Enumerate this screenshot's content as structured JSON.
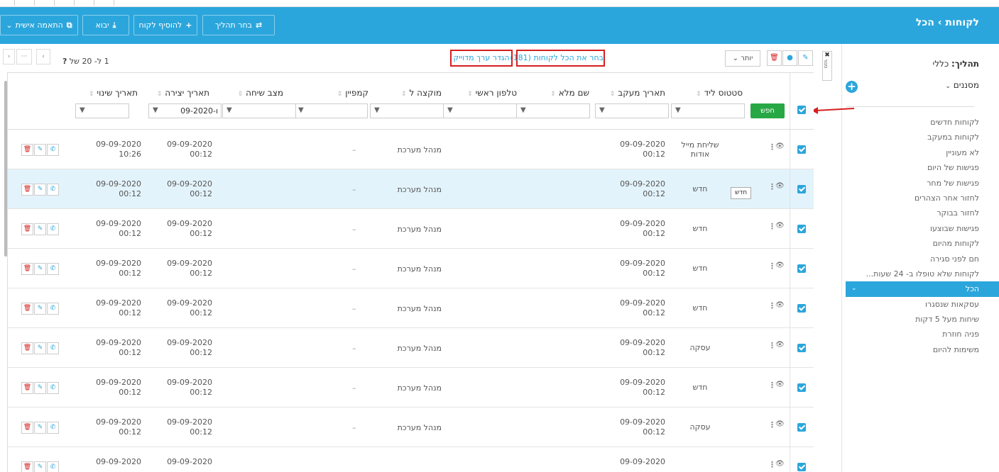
{
  "header": {
    "title": "לקוחות › הכל",
    "buttons": [
      {
        "label": "התאמה אישית",
        "icon": "copy-icon",
        "chev": "⌄"
      },
      {
        "label": "יבוא",
        "icon": "download-icon"
      },
      {
        "label": "להוסיף לקוח",
        "icon": "plus-icon"
      },
      {
        "label": "בחר תהליך",
        "icon": "swap-icon"
      }
    ]
  },
  "sidebar": {
    "process_label": "תהליך:",
    "process_value": "כללי",
    "filters_label": "מסננים",
    "items": [
      {
        "label": "לקוחות חדשים"
      },
      {
        "label": "לקוחות במעקב"
      },
      {
        "label": "לא מעוניין"
      },
      {
        "label": "פגישות של היום"
      },
      {
        "label": "פגישות של מחר"
      },
      {
        "label": "לחזור אחר הצהרים"
      },
      {
        "label": "לחזור בבוקר"
      },
      {
        "label": "פגישות שבוצעו"
      },
      {
        "label": "לקוחות מהיום"
      },
      {
        "label": "חם לפני סגירה"
      },
      {
        "label": "לקוחות שלא טופלו ב- 24 שעות..."
      },
      {
        "label": "הכל",
        "active": true
      },
      {
        "label": "עסקאות שנסגרו"
      },
      {
        "label": "שיחות מעל 5 דקות"
      },
      {
        "label": "פניה חוזרת"
      },
      {
        "label": "משימות להיום"
      }
    ],
    "close_tab_label": "סגור",
    "close_glyph": "✖"
  },
  "toolbar": {
    "more_label": "יותר",
    "select_all": "בחר את הכל לקוחות (181)",
    "define_exact": "הגדר ערך מדוייק",
    "pager_text": "1 ל- 20 של",
    "pager_total": "?",
    "pg_prev": "‹",
    "pg_more": "···",
    "pg_next": "›"
  },
  "table": {
    "search_label": "חפש",
    "sort_glyph": "⇕",
    "columns": [
      {
        "key": "status",
        "label": "סטטוס ליד"
      },
      {
        "key": "followup",
        "label": "תאריך מעקב"
      },
      {
        "key": "fullname",
        "label": "שם מלא"
      },
      {
        "key": "phone",
        "label": "טלפון ראשי"
      },
      {
        "key": "assigned",
        "label": "מוקצה ל"
      },
      {
        "key": "campaign",
        "label": "קמפיין"
      },
      {
        "key": "callstatus",
        "label": "מצב שיחה"
      },
      {
        "key": "created",
        "label": "תאריך יצירה"
      },
      {
        "key": "changed",
        "label": "תאריך שינוי"
      }
    ],
    "created_filter_value": "09-2020-ו",
    "rows": [
      {
        "status": "שליחת מייל אודות",
        "followup_date": "09-09-2020",
        "followup_time": "00:12",
        "assigned": "מנהל מערכת",
        "campaign": "–",
        "created_date": "09-09-2020",
        "created_time": "00:12",
        "changed_date": "09-09-2020",
        "changed_time": "10:26"
      },
      {
        "status": "חדש",
        "followup_date": "09-09-2020",
        "followup_time": "00:12",
        "assigned": "מנהל מערכת",
        "campaign": "–",
        "created_date": "09-09-2020",
        "created_time": "00:12",
        "changed_date": "09-09-2020",
        "changed_time": "00:12",
        "highlight": true,
        "tooltip": "חדש"
      },
      {
        "status": "חדש",
        "followup_date": "09-09-2020",
        "followup_time": "00:12",
        "assigned": "מנהל מערכת",
        "campaign": "–",
        "created_date": "09-09-2020",
        "created_time": "00:12",
        "changed_date": "09-09-2020",
        "changed_time": "00:12"
      },
      {
        "status": "חדש",
        "followup_date": "09-09-2020",
        "followup_time": "00:12",
        "assigned": "מנהל מערכת",
        "campaign": "–",
        "created_date": "09-09-2020",
        "created_time": "00:12",
        "changed_date": "09-09-2020",
        "changed_time": "00:12"
      },
      {
        "status": "חדש",
        "followup_date": "09-09-2020",
        "followup_time": "00:12",
        "assigned": "מנהל מערכת",
        "campaign": "–",
        "created_date": "09-09-2020",
        "created_time": "00:12",
        "changed_date": "09-09-2020",
        "changed_time": "00:12"
      },
      {
        "status": "עסקה",
        "followup_date": "09-09-2020",
        "followup_time": "00:12",
        "assigned": "מנהל מערכת",
        "campaign": "–",
        "created_date": "09-09-2020",
        "created_time": "00:12",
        "changed_date": "09-09-2020",
        "changed_time": "00:12"
      },
      {
        "status": "חדש",
        "followup_date": "09-09-2020",
        "followup_time": "00:12",
        "assigned": "מנהל מערכת",
        "campaign": "–",
        "created_date": "09-09-2020",
        "created_time": "00:12",
        "changed_date": "09-09-2020",
        "changed_time": "00:12"
      },
      {
        "status": "עסקה",
        "followup_date": "09-09-2020",
        "followup_time": "00:12",
        "assigned": "מנהל מערכת",
        "campaign": "–",
        "created_date": "09-09-2020",
        "created_time": "00:12",
        "changed_date": "09-09-2020",
        "changed_time": "00:12"
      },
      {
        "status": "",
        "followup_date": "09-09-2020",
        "followup_time": "",
        "assigned": "",
        "campaign": "",
        "created_date": "09-09-2020",
        "created_time": "",
        "changed_date": "09-09-2020",
        "changed_time": ""
      }
    ]
  },
  "colors": {
    "header_bg": "#2ba6dc",
    "accent": "#2ba6dc",
    "search_green": "#27a844",
    "highlight_red": "#d61f1f",
    "row_highlight": "#e3f3fb"
  },
  "icons": {
    "filter": "▼",
    "eye": "👁",
    "delete": "🗑",
    "edit": "✎",
    "call": "✆",
    "chevron_down": "⌄",
    "chevron_down_sb": "⌄"
  }
}
